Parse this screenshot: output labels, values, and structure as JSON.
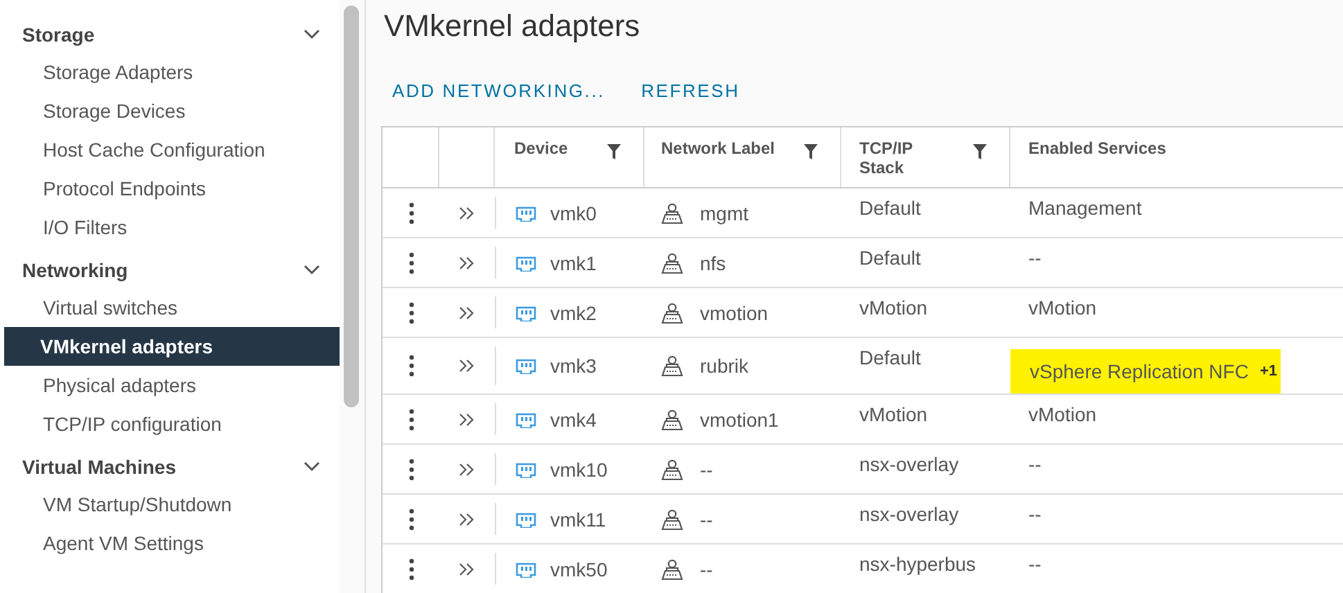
{
  "sidebar": {
    "groups": [
      {
        "title": "Storage",
        "expanded": true,
        "items": [
          {
            "label": "Storage Adapters",
            "selected": false
          },
          {
            "label": "Storage Devices",
            "selected": false
          },
          {
            "label": "Host Cache Configuration",
            "selected": false
          },
          {
            "label": "Protocol Endpoints",
            "selected": false
          },
          {
            "label": "I/O Filters",
            "selected": false
          }
        ]
      },
      {
        "title": "Networking",
        "expanded": true,
        "items": [
          {
            "label": "Virtual switches",
            "selected": false
          },
          {
            "label": "VMkernel adapters",
            "selected": true
          },
          {
            "label": "Physical adapters",
            "selected": false
          },
          {
            "label": "TCP/IP configuration",
            "selected": false
          }
        ]
      },
      {
        "title": "Virtual Machines",
        "expanded": true,
        "items": [
          {
            "label": "VM Startup/Shutdown",
            "selected": false
          },
          {
            "label": "Agent VM Settings",
            "selected": false
          }
        ]
      }
    ]
  },
  "page": {
    "title": "VMkernel adapters",
    "actions": [
      "ADD NETWORKING...",
      "REFRESH"
    ]
  },
  "table": {
    "columns": [
      {
        "label": "Device",
        "filter": true
      },
      {
        "label": "Network Label",
        "filter": true
      },
      {
        "label": "TCP/IP Stack",
        "filter": true
      },
      {
        "label": "Enabled Services",
        "filter": false
      }
    ],
    "rows": [
      {
        "device": "vmk0",
        "network_label": "mgmt",
        "stack": "Default",
        "services": "Management",
        "highlighted": false
      },
      {
        "device": "vmk1",
        "network_label": "nfs",
        "stack": "Default",
        "services": "--",
        "highlighted": false
      },
      {
        "device": "vmk2",
        "network_label": "vmotion",
        "stack": "vMotion",
        "services": "vMotion",
        "highlighted": false
      },
      {
        "device": "vmk3",
        "network_label": "rubrik",
        "stack": "Default",
        "services": "vSphere Replication NFC",
        "more": "+1",
        "highlighted": true
      },
      {
        "device": "vmk4",
        "network_label": "vmotion1",
        "stack": "vMotion",
        "services": "vMotion",
        "highlighted": false
      },
      {
        "device": "vmk10",
        "network_label": "--",
        "stack": "nsx-overlay",
        "services": "--",
        "highlighted": false
      },
      {
        "device": "vmk11",
        "network_label": "--",
        "stack": "nsx-overlay",
        "services": "--",
        "highlighted": false
      },
      {
        "device": "vmk50",
        "network_label": "--",
        "stack": "nsx-hyperbus",
        "services": "--",
        "highlighted": false
      }
    ]
  }
}
